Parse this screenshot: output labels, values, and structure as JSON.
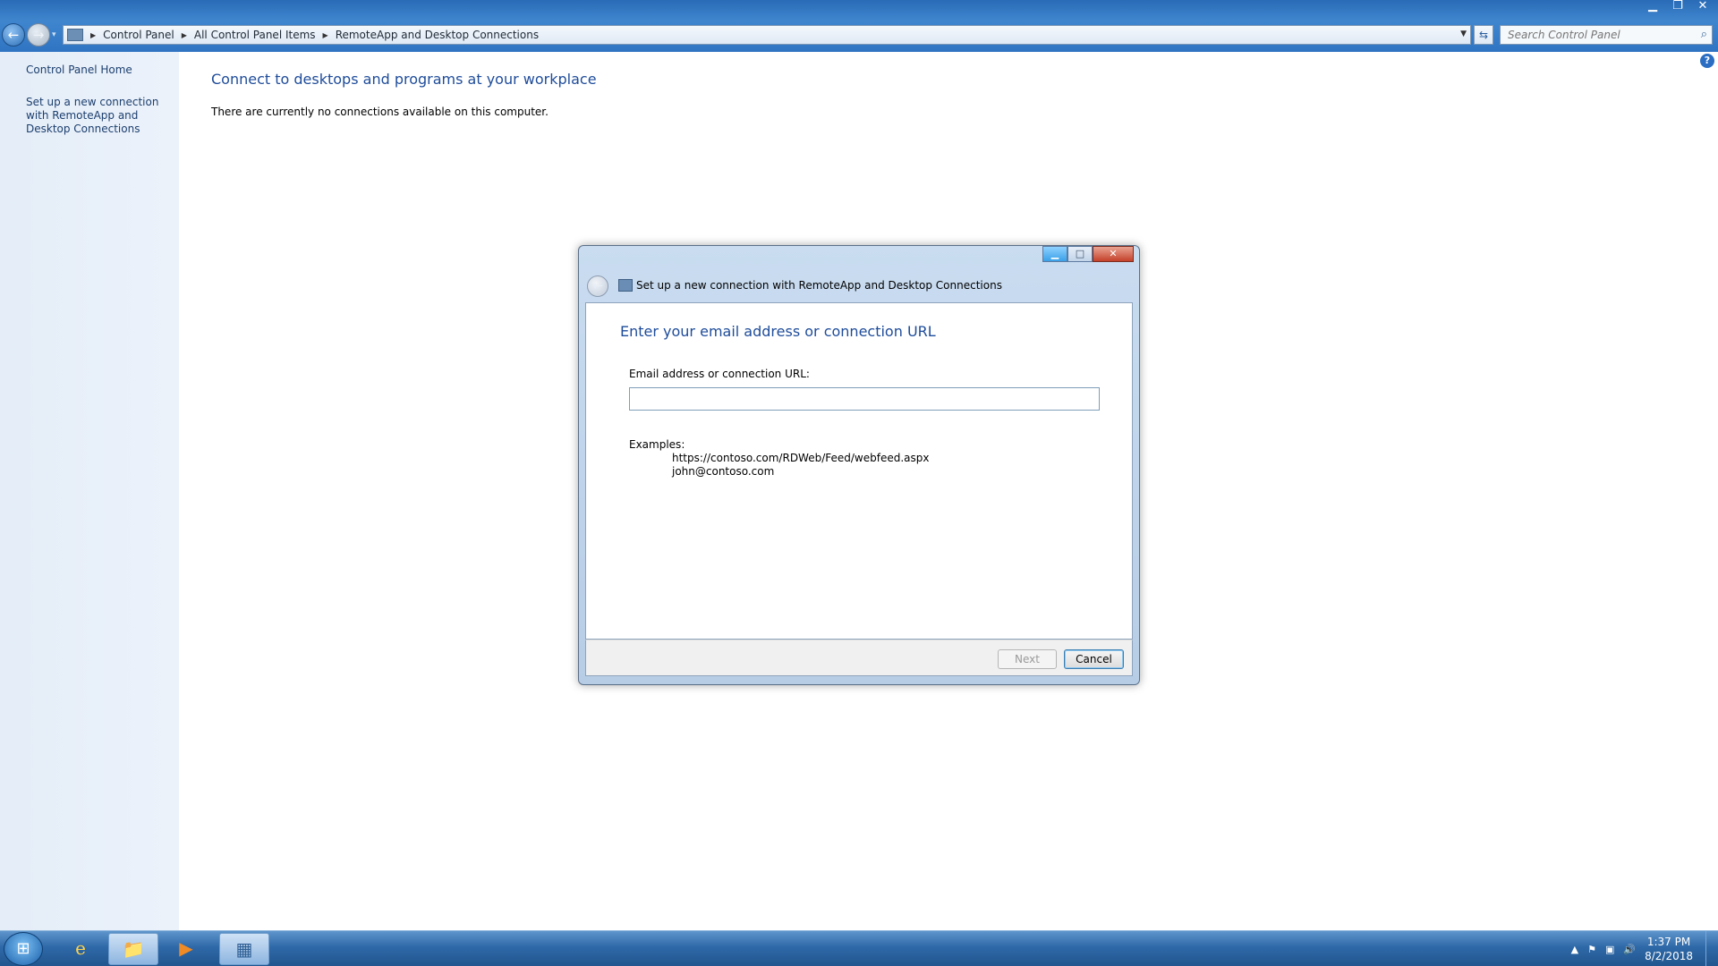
{
  "window": {
    "minimize_glyph": "▁",
    "restore_glyph": "❐",
    "close_glyph": "✕"
  },
  "navigation": {
    "back_glyph": "←",
    "forward_glyph": "→",
    "recent_glyph": "▾"
  },
  "address": {
    "breadcrumbs": [
      "Control Panel",
      "All Control Panel Items",
      "RemoteApp and Desktop Connections"
    ],
    "separator_glyph": "▶",
    "dropdown_glyph": "▼",
    "refresh_glyph": "⇆"
  },
  "search": {
    "placeholder": "Search Control Panel",
    "icon": "search-icon"
  },
  "sidebar": {
    "items": [
      {
        "label": "Control Panel Home"
      },
      {
        "label": "Set up a new connection with RemoteApp and Desktop Connections"
      }
    ]
  },
  "main": {
    "title": "Connect to desktops and programs at your workplace",
    "status": "There are currently no connections available on this computer.",
    "help_glyph": "?"
  },
  "dialog": {
    "title": "Set up a new connection with RemoteApp and Desktop Connections",
    "heading": "Enter your email address or connection URL",
    "field_label": "Email address or connection URL:",
    "field_value": "",
    "examples_label": "Examples:",
    "examples": [
      "https://contoso.com/RDWeb/Feed/webfeed.aspx",
      "john@contoso.com"
    ],
    "next_label": "Next",
    "cancel_label": "Cancel",
    "minimize_glyph": "▁",
    "maximize_glyph": "□",
    "close_glyph": "✕",
    "back_glyph": "←"
  },
  "taskbar": {
    "start_glyph": "⊞",
    "items": [
      {
        "name": "internet-explorer",
        "glyph": "e"
      },
      {
        "name": "windows-explorer",
        "glyph": "📁"
      },
      {
        "name": "media-player",
        "glyph": "▶"
      },
      {
        "name": "control-panel",
        "glyph": "▦"
      }
    ],
    "tray": {
      "show_hidden_glyph": "▲",
      "flag_glyph": "⚑",
      "network_glyph": "▣",
      "volume_glyph": "🔊"
    },
    "clock": {
      "time": "1:37 PM",
      "date": "8/2/2018"
    }
  },
  "colors": {
    "accent": "#1e4c9a",
    "titlebar": "#3f86cf",
    "sidebar": "#e4edf8"
  }
}
